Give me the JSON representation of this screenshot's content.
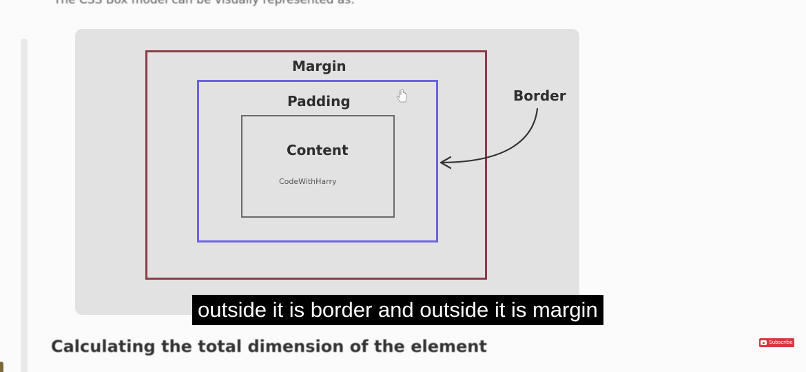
{
  "page": {
    "intro_text": "The CSS Box model can be visually represented as:",
    "section_heading": "Calculating the total dimension of the element"
  },
  "diagram": {
    "margin_label": "Margin",
    "padding_label": "Padding",
    "content_label": "Content",
    "content_sublabel": "CodeWithHarry",
    "border_label": "Border",
    "colors": {
      "margin_box": "#8a3b48",
      "padding_box": "#6b63e0",
      "content_box": "#6a6a6a",
      "panel": "#e2e2e2"
    }
  },
  "video_overlay": {
    "subtitle": "outside it is border and outside it is margin",
    "subscribe_label": "Subscribe",
    "subscribe_icon": "youtube-play-icon",
    "subscribe_color": "#d9363e"
  }
}
